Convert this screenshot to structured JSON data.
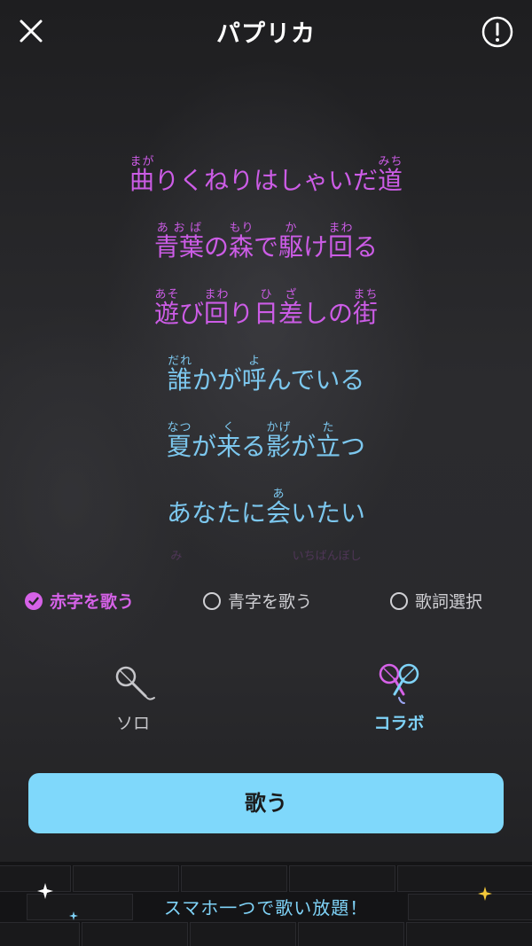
{
  "header": {
    "title": "パプリカ"
  },
  "lyrics": {
    "line1": [
      {
        "kanji": "曲",
        "ruby": "まが"
      },
      {
        "text": "りくねりはしゃいだ"
      },
      {
        "kanji": "道",
        "ruby": "みち"
      }
    ],
    "line2": [
      {
        "kanji": "青葉",
        "ruby": "あおば"
      },
      {
        "text": "の"
      },
      {
        "kanji": "森",
        "ruby": "もり"
      },
      {
        "text": "で"
      },
      {
        "kanji": "駆",
        "ruby": "か"
      },
      {
        "text": "け"
      },
      {
        "kanji": "回",
        "ruby": "まわ"
      },
      {
        "text": "る"
      }
    ],
    "line3": [
      {
        "kanji": "遊",
        "ruby": "あそ"
      },
      {
        "text": "び"
      },
      {
        "kanji": "回",
        "ruby": "まわ"
      },
      {
        "text": "り"
      },
      {
        "kanji": "日差",
        "ruby": "ひざ"
      },
      {
        "text": "しの"
      },
      {
        "kanji": "街",
        "ruby": "まち"
      }
    ],
    "line4": [
      {
        "kanji": "誰",
        "ruby": "だれ"
      },
      {
        "text": "かが"
      },
      {
        "kanji": "呼",
        "ruby": "よ"
      },
      {
        "text": "んでいる"
      }
    ],
    "line5": [
      {
        "kanji": "夏",
        "ruby": "なつ"
      },
      {
        "text": "が"
      },
      {
        "kanji": "来",
        "ruby": "く"
      },
      {
        "text": "る"
      },
      {
        "kanji": "影",
        "ruby": "かげ"
      },
      {
        "text": "が"
      },
      {
        "kanji": "立",
        "ruby": "た"
      },
      {
        "text": "つ"
      }
    ],
    "line6": [
      {
        "text": "あなたに"
      },
      {
        "kanji": "会",
        "ruby": "あ"
      },
      {
        "text": "いたい"
      }
    ],
    "faded_left": "み",
    "faded_right": "いちばんぼし"
  },
  "options": {
    "red": "赤字を歌う",
    "blue": "青字を歌う",
    "select": "歌詞選択",
    "selected": "red"
  },
  "modes": {
    "solo": "ソロ",
    "collab": "コラボ",
    "selected": "collab"
  },
  "sing_button": "歌う",
  "footer": {
    "text": "スマホ一つで歌い放題！"
  },
  "colors": {
    "red_part": "#cc5ce6",
    "blue_part": "#7cc7ee",
    "accent": "#7fd8fb"
  },
  "icons": {
    "close": "close-icon",
    "info": "info-icon",
    "solo": "microphone-icon",
    "collab": "duet-microphones-icon",
    "check": "checkmark-icon"
  }
}
